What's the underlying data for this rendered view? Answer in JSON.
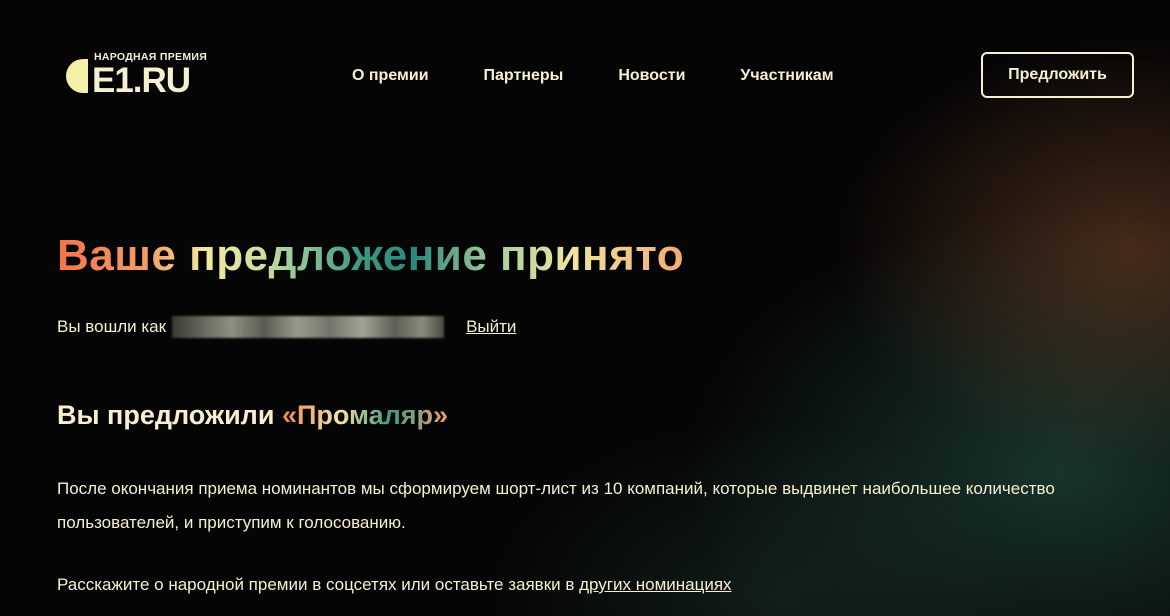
{
  "header": {
    "logo_small": "НАРОДНАЯ ПРЕМИЯ",
    "logo_big": "E1.RU",
    "nav": [
      {
        "label": "О премии"
      },
      {
        "label": "Партнеры"
      },
      {
        "label": "Новости"
      },
      {
        "label": "Участникам"
      }
    ],
    "suggest_label": "Предложить"
  },
  "main": {
    "title": "Ваше предложение принято",
    "login_prefix": "Вы вошли как",
    "logout_label": "Выйти",
    "suggested_prefix": "Вы предложили",
    "suggested_name": "«Промаляр»",
    "paragraph": "После окончания приема номинантов мы сформируем шорт-лист из 10 компаний, которые выдвинет наибольшее количество пользователей, и приступим к голосованию.",
    "share_text": "Расскажите о народной премии в соцсетях или оставьте заявки в ",
    "share_link": "других номинациях"
  },
  "colors": {
    "text": "#f6efd0",
    "background": "#050505",
    "accent_orange": "#f4734b",
    "accent_teal": "#2c877a",
    "accent_cream": "#f2e9a2"
  }
}
